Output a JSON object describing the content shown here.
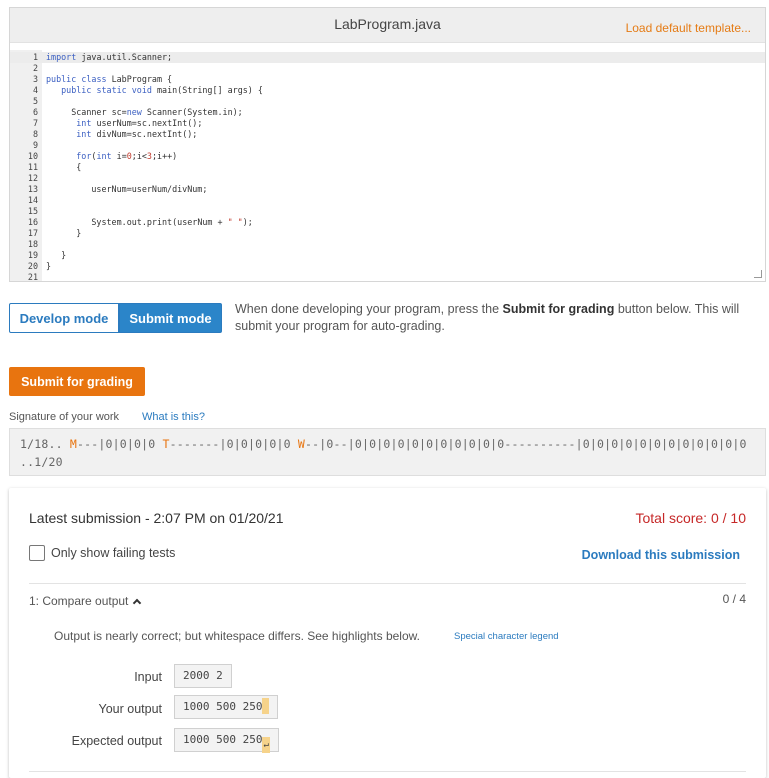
{
  "editor": {
    "title": "LabProgram.java",
    "load_template": "Load default template...",
    "lines": [
      {
        "n": "1",
        "t": "import java.util.Scanner;"
      },
      {
        "n": "2",
        "t": ""
      },
      {
        "n": "3",
        "t": "public class LabProgram {"
      },
      {
        "n": "4",
        "t": "   public static void main(String[] args) {"
      },
      {
        "n": "5",
        "t": ""
      },
      {
        "n": "6",
        "t": "     Scanner sc=new Scanner(System.in);"
      },
      {
        "n": "7",
        "t": "      int userNum=sc.nextInt();"
      },
      {
        "n": "8",
        "t": "      int divNum=sc.nextInt();"
      },
      {
        "n": "9",
        "t": ""
      },
      {
        "n": "10",
        "t": "      for(int i=0;i<3;i++)"
      },
      {
        "n": "11",
        "t": "      {"
      },
      {
        "n": "12",
        "t": ""
      },
      {
        "n": "13",
        "t": "         userNum=userNum/divNum;"
      },
      {
        "n": "14",
        "t": ""
      },
      {
        "n": "15",
        "t": ""
      },
      {
        "n": "16",
        "t": "         System.out.print(userNum + \" \");"
      },
      {
        "n": "17",
        "t": "      }"
      },
      {
        "n": "18",
        "t": ""
      },
      {
        "n": "19",
        "t": "   }"
      },
      {
        "n": "20",
        "t": "}"
      },
      {
        "n": "21",
        "t": ""
      }
    ]
  },
  "mode": {
    "develop_label": "Develop mode",
    "submit_label": "Submit mode",
    "desc_pre": "When done developing your program, press the ",
    "desc_bold": "Submit for grading",
    "desc_post": " button below. This will submit your program for auto-grading."
  },
  "submit_button": "Submit for grading",
  "signature": {
    "label": "Signature of your work",
    "help": "What is this?",
    "part1": "1/18.. ",
    "m1": "M",
    "part2": "---|0|0|0|0 ",
    "m2": "T",
    "part3": "-------|0|0|0|0|0 ",
    "m3": "W",
    "part4": "--|0--|0|0|0|0|0|0|0|0|0|0|0----------|0|0|0|0|0|0|0|0|0|0|0|0 ..1/20"
  },
  "results": {
    "latest": "Latest submission - 2:07 PM on 01/20/21",
    "total_score": "Total score: 0 / 10",
    "only_failing": "Only show failing tests",
    "download": "Download this submission",
    "test_title": "1: Compare output",
    "test_score": "0 / 4",
    "message": "Output is nearly correct; but whitespace differs. See highlights below.",
    "legend": "Special character legend",
    "input_label": "Input",
    "input_value": "2000 2",
    "your_label": "Your output",
    "your_value": "1000 500 250",
    "expected_label": "Expected output",
    "expected_value": "1000 500 250",
    "return_glyph": "↵"
  },
  "colors": {
    "accent_orange": "#e8740f",
    "accent_blue": "#2b85c9",
    "score_red": "#c62828",
    "whitespace_highlight": "#f6d38b"
  }
}
